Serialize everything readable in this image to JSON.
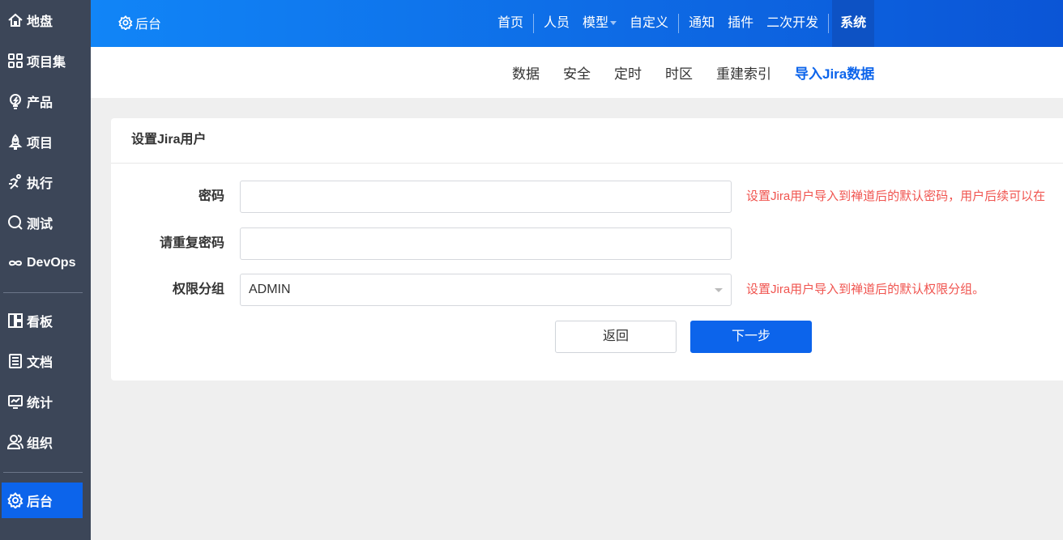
{
  "sidebar": {
    "items": [
      {
        "label": "地盘",
        "icon": "home-icon"
      },
      {
        "label": "项目集",
        "icon": "grid-icon"
      },
      {
        "label": "产品",
        "icon": "lightbulb-icon"
      },
      {
        "label": "项目",
        "icon": "rocket-icon"
      },
      {
        "label": "执行",
        "icon": "run-icon"
      },
      {
        "label": "测试",
        "icon": "search-icon"
      },
      {
        "label": "DevOps",
        "icon": "infinity-icon"
      },
      {
        "label": "看板",
        "icon": "kanban-icon"
      },
      {
        "label": "文档",
        "icon": "document-icon"
      },
      {
        "label": "统计",
        "icon": "chart-icon"
      },
      {
        "label": "组织",
        "icon": "users-icon"
      },
      {
        "label": "后台",
        "icon": "gear-icon"
      }
    ]
  },
  "header": {
    "brand": "后台",
    "nav": [
      "首页",
      "人员",
      "模型",
      "自定义",
      "通知",
      "插件",
      "二次开发",
      "系统"
    ]
  },
  "subnav": [
    "数据",
    "安全",
    "定时",
    "时区",
    "重建索引",
    "导入Jira数据"
  ],
  "panel": {
    "title": "设置Jira用户",
    "password_label": "密码",
    "password_value": "",
    "password_hint": "设置Jira用户导入到禅道后的默认密码，用户后续可以在",
    "repeat_label": "请重复密码",
    "repeat_value": "",
    "group_label": "权限分组",
    "group_value": "ADMIN",
    "group_hint": "设置Jira用户导入到禅道后的默认权限分组。",
    "back_label": "返回",
    "next_label": "下一步"
  }
}
